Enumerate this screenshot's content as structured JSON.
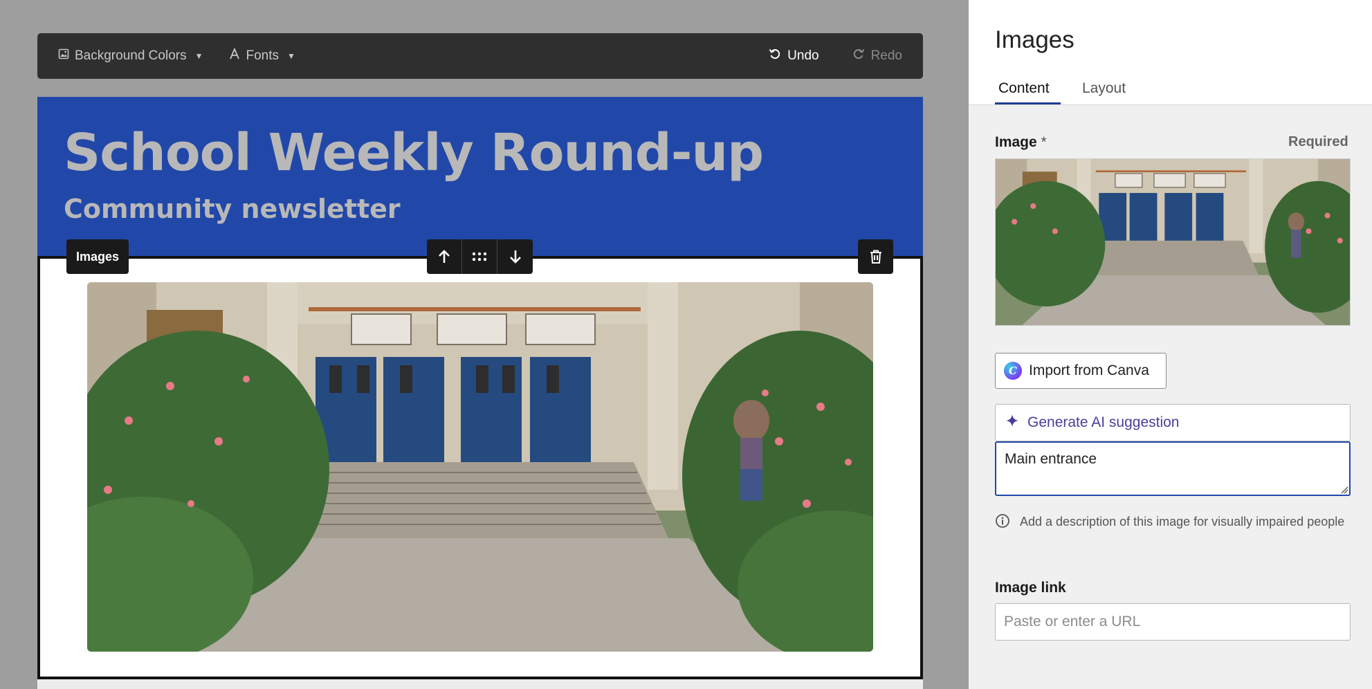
{
  "toolbar": {
    "background_colors": "Background Colors",
    "fonts": "Fonts",
    "undo": "Undo",
    "redo": "Redo"
  },
  "newsletter": {
    "title": "School Weekly Round-up",
    "subtitle": "Community newsletter"
  },
  "block": {
    "label": "Images"
  },
  "panel": {
    "title": "Images",
    "tabs": [
      "Content",
      "Layout"
    ],
    "active_tab": "Content",
    "image_label": "Image",
    "required_star": "*",
    "required_note": "Required",
    "import_canva": "Import from Canva",
    "generate_ai": "Generate AI suggestion",
    "alt_text_value": "Main entrance",
    "help_text": "Add a description of this image for visually impaired people",
    "image_link_label": "Image link",
    "image_link_placeholder": "Paste or enter a URL",
    "image_link_value": ""
  },
  "colors": {
    "header_blue": "#2148a9",
    "toolbar_bg": "#2f2f2f",
    "ai_purple": "#4a3d9c",
    "focus_border": "#2148a9"
  }
}
